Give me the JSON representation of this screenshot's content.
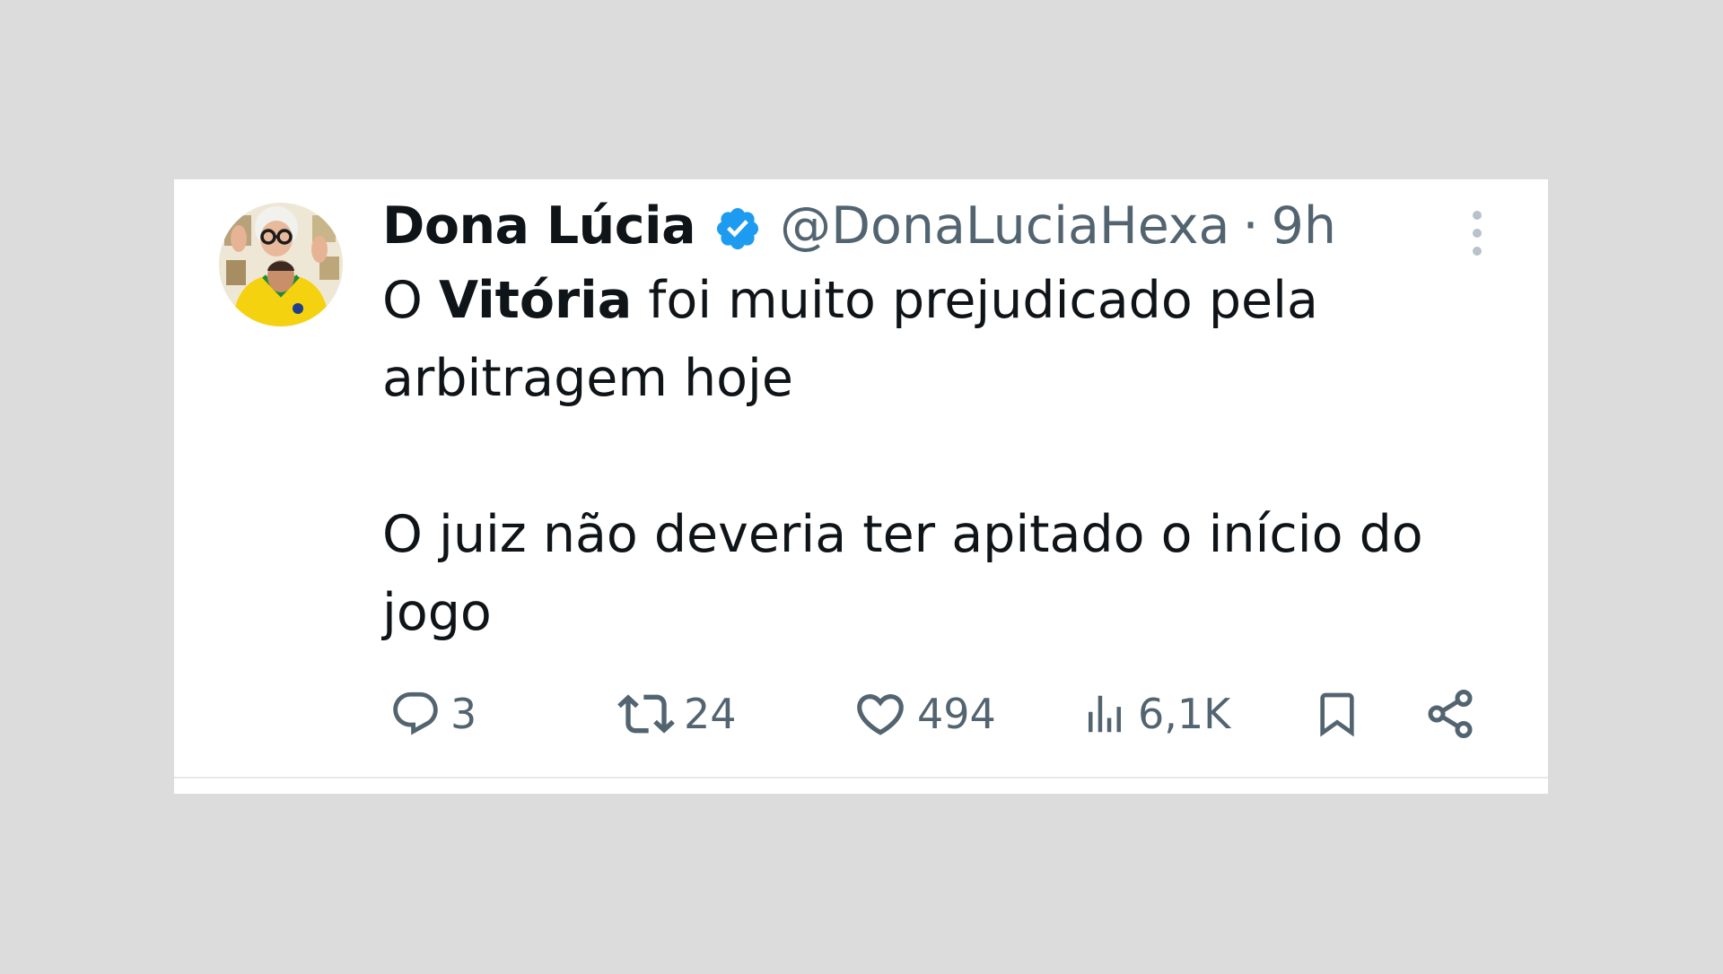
{
  "tweet": {
    "author": {
      "display_name": "Dona Lúcia",
      "handle": "@DonaLuciaHexa",
      "verified": true,
      "avatar_icon": "avatar-photo"
    },
    "separator": "·",
    "time": "9h",
    "text": {
      "line1_prefix": "O ",
      "line1_bold": "Vitória",
      "line1_suffix": " foi muito prejudicado pela arbitragem hoje",
      "paragraph2": "O juiz não deveria ter apitado o início do jogo"
    },
    "actions": {
      "replies": "3",
      "retweets": "24",
      "likes": "494",
      "views": "6,1K"
    },
    "icons": {
      "verified": "verified-badge-icon",
      "more": "more-vertical-icon",
      "reply": "reply-icon",
      "retweet": "retweet-icon",
      "like": "heart-icon",
      "views": "views-icon",
      "bookmark": "bookmark-icon",
      "share": "share-icon"
    },
    "colors": {
      "accent": "#1d9bf0",
      "text": "#0f1419",
      "secondary": "#536471",
      "background": "#dcdcdc"
    }
  }
}
